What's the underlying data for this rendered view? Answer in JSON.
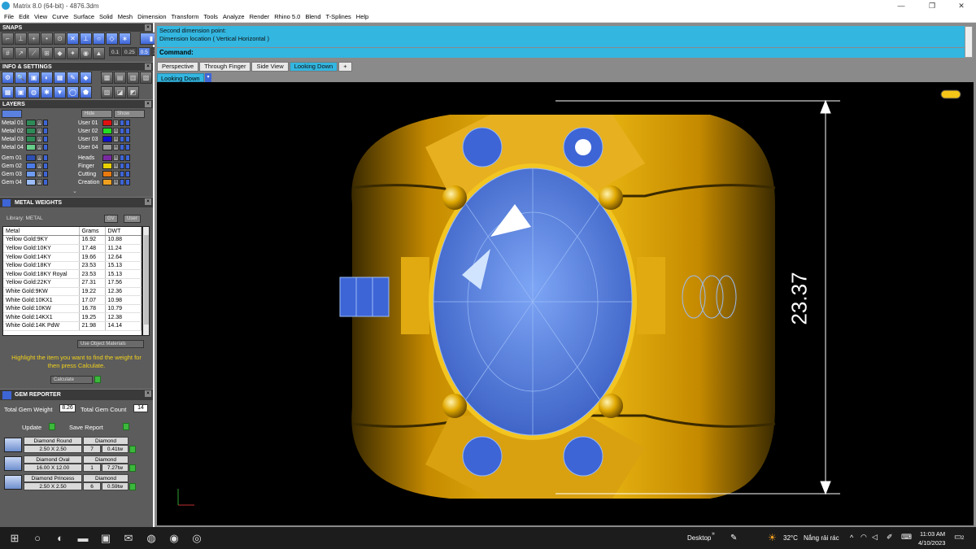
{
  "window": {
    "title": "Matrix 8.0 (64-bit) - 4876.3dm",
    "min": "—",
    "max": "❐",
    "close": "✕"
  },
  "menu": [
    "File",
    "Edit",
    "View",
    "Curve",
    "Surface",
    "Solid",
    "Mesh",
    "Dimension",
    "Transform",
    "Tools",
    "Analyze",
    "Render",
    "Rhino 5.0",
    "Blend",
    "T-Splines",
    "Help"
  ],
  "snaps": {
    "title": "SNAPS",
    "values": [
      "0.1",
      "0.25",
      "0.5",
      "1.0"
    ],
    "active_value": "0.5"
  },
  "info": {
    "title": "INFO & SETTINGS"
  },
  "layers": {
    "title": "LAYERS",
    "hide_label": "Hide",
    "show_label": "Show",
    "left": [
      {
        "name": "Metal 01",
        "color": "#2e8b57"
      },
      {
        "name": "Metal 02",
        "color": "#2e8b57"
      },
      {
        "name": "Metal 03",
        "color": "#2e8b57"
      },
      {
        "name": "Metal 04",
        "color": "#66cc88"
      },
      {
        "name": "Gem 01",
        "color": "#2e4fb0"
      },
      {
        "name": "Gem 02",
        "color": "#4a7be8"
      },
      {
        "name": "Gem 03",
        "color": "#6e9cf0"
      },
      {
        "name": "Gem 04",
        "color": "#9bbcf7"
      }
    ],
    "right": [
      {
        "name": "User 01",
        "color": "#e01010"
      },
      {
        "name": "User 02",
        "color": "#22dd22"
      },
      {
        "name": "User 03",
        "color": "#1010d0"
      },
      {
        "name": "User 04",
        "color": "#999999"
      },
      {
        "name": "Heads",
        "color": "#7a2aa0"
      },
      {
        "name": "Finger",
        "color": "#e8d000"
      },
      {
        "name": "Cutting",
        "color": "#e87a10"
      },
      {
        "name": "Creation",
        "color": "#f0a020"
      }
    ]
  },
  "metal_weights": {
    "title": "METAL WEIGHTS",
    "library_label": "Library: METAL",
    "gv": "GV",
    "user": "User",
    "headers": [
      "Metal",
      "Grams",
      "DWT"
    ],
    "rows": [
      [
        "Yellow Gold:9KY",
        "16.92",
        "10.88"
      ],
      [
        "Yellow Gold:10KY",
        "17.48",
        "11.24"
      ],
      [
        "Yellow Gold:14KY",
        "19.66",
        "12.64"
      ],
      [
        "Yellow Gold:18KY",
        "23.53",
        "15.13"
      ],
      [
        "Yellow Gold:18KY Royal",
        "23.53",
        "15.13"
      ],
      [
        "Yellow Gold:22KY",
        "27.31",
        "17.56"
      ],
      [
        "White Gold:9KW",
        "19.22",
        "12.36"
      ],
      [
        "White Gold:10KX1",
        "17.07",
        "10.98"
      ],
      [
        "White Gold:10KW",
        "16.78",
        "10.79"
      ],
      [
        "White Gold:14KX1",
        "19.25",
        "12.38"
      ],
      [
        "White Gold:14K PdW",
        "21.98",
        "14.14"
      ]
    ],
    "use_object_materials": "Use Object Materials",
    "hint": "Highlight the item you want to find the weight for then press Calculate.",
    "calculate": "Calculate"
  },
  "gem_reporter": {
    "title": "GEM REPORTER",
    "total_weight_label": "Total Gem Weight",
    "total_weight": "8.26",
    "total_count_label": "Total Gem Count",
    "total_count": "14",
    "update": "Update",
    "save_report": "Save Report",
    "gems": [
      {
        "shape": "Diamond Round",
        "size": "2.50 X 2.50",
        "material": "Diamond",
        "count": "7",
        "weight": "0.41tw"
      },
      {
        "shape": "Diamond Oval",
        "size": "16.00 X 12.00",
        "material": "Diamond",
        "count": "1",
        "weight": "7.27tw"
      },
      {
        "shape": "Diamond Princess",
        "size": "2.50 X 2.50",
        "material": "Diamond",
        "count": "6",
        "weight": "0.59tw"
      }
    ]
  },
  "command": {
    "history1": "Second dimension point:",
    "history2": "Dimension location ( Vertical  Horizontal )",
    "label": "Command:"
  },
  "tabs": [
    "Perspective",
    "Through Finger",
    "Side View",
    "Looking Down"
  ],
  "active_tab": "Looking Down",
  "viewport": {
    "label": "Looking Down",
    "dimension": "23.37",
    "axis_x": "x",
    "axis_y": "y"
  },
  "taskbar": {
    "desktop": "Desktop",
    "temp": "32°C",
    "weather": "Nắng rải rác",
    "time": "11:03 AM",
    "date": "4/10/2023",
    "notif": "2"
  }
}
